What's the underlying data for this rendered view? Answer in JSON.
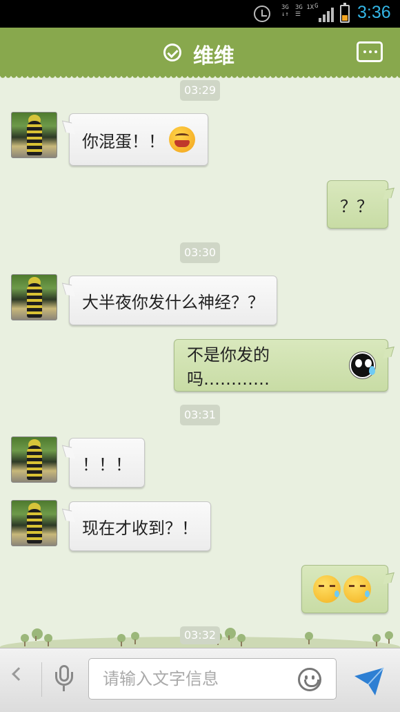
{
  "status_bar": {
    "net_left": "3G",
    "net_right": "3G 1X",
    "net_g": "G",
    "time": "3:36",
    "battery_level": 0.35,
    "time_color": "#33b5e5"
  },
  "header": {
    "title": "维维",
    "accent": "#88a84d"
  },
  "messages": [
    {
      "type": "timestamp",
      "text": "03:29"
    },
    {
      "type": "incoming",
      "text": "你混蛋！！",
      "emoji": "angry-emoji"
    },
    {
      "type": "outgoing",
      "text": "？？"
    },
    {
      "type": "timestamp",
      "text": "03:30"
    },
    {
      "type": "incoming",
      "text": "大半夜你发什么神经？？"
    },
    {
      "type": "outgoing",
      "text": "不是你发的吗…………",
      "emoji": "sweat-emoji"
    },
    {
      "type": "timestamp",
      "text": "03:31"
    },
    {
      "type": "incoming",
      "text": "！！！"
    },
    {
      "type": "incoming",
      "text": "现在才收到？！"
    },
    {
      "type": "outgoing",
      "text": "",
      "emoji": "meh-emoji ×2"
    },
    {
      "type": "timestamp",
      "text": "03:32"
    }
  ],
  "input_bar": {
    "placeholder": "请输入文字信息",
    "send_color": "#2d7fd3"
  }
}
